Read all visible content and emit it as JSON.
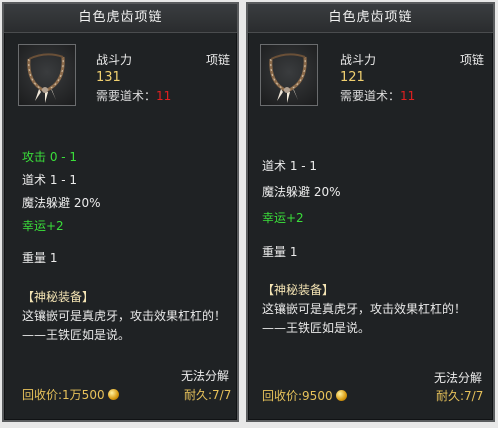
{
  "panels": [
    {
      "title": "白色虎齿项链",
      "power_label": "战斗力",
      "power_value": "131",
      "req_label": "需要道术：",
      "req_value": "11",
      "type": "项链",
      "attack": "攻击 0 - 1",
      "taoism": "道术 1 - 1",
      "magic_evade": "魔法躲避 20%",
      "luck": "幸运+2",
      "weight": "重量 1",
      "mystery_title": "【神秘装备】",
      "desc": "这镶嵌可是真虎牙，攻击效果杠杠的！——王铁匠如是说。",
      "no_decompose": "无法分解",
      "recycle_label": "回收价:",
      "recycle_value": "1万500",
      "durability_label": "耐久:",
      "durability_value": "7/7"
    },
    {
      "title": "白色虎齿项链",
      "power_label": "战斗力",
      "power_value": "121",
      "req_label": "需要道术：",
      "req_value": "11",
      "type": "项链",
      "taoism": "道术 1 - 1",
      "magic_evade": "魔法躲避 20%",
      "luck": "幸运+2",
      "weight": "重量 1",
      "mystery_title": "【神秘装备】",
      "desc": "这镶嵌可是真虎牙，攻击效果杠杠的！——王铁匠如是说。",
      "no_decompose": "无法分解",
      "recycle_label": "回收价:",
      "recycle_value": "9500",
      "durability_label": "耐久:",
      "durability_value": "7/7"
    }
  ],
  "colors": {
    "panel_bg": "#1f2224",
    "value_gold": "#f0d070",
    "requirement_red": "#e02020",
    "positive_green": "#3adf3a",
    "footer_gold": "#e6c15a"
  },
  "icons": [
    "necklace-icon",
    "gold-coin-icon"
  ]
}
